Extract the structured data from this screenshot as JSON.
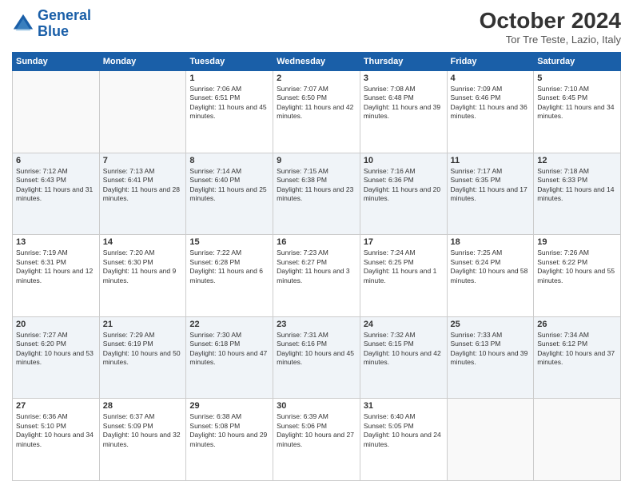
{
  "logo": {
    "line1": "General",
    "line2": "Blue"
  },
  "title": "October 2024",
  "subtitle": "Tor Tre Teste, Lazio, Italy",
  "headers": [
    "Sunday",
    "Monday",
    "Tuesday",
    "Wednesday",
    "Thursday",
    "Friday",
    "Saturday"
  ],
  "weeks": [
    [
      {
        "day": "",
        "details": ""
      },
      {
        "day": "",
        "details": ""
      },
      {
        "day": "1",
        "details": "Sunrise: 7:06 AM\nSunset: 6:51 PM\nDaylight: 11 hours and 45 minutes."
      },
      {
        "day": "2",
        "details": "Sunrise: 7:07 AM\nSunset: 6:50 PM\nDaylight: 11 hours and 42 minutes."
      },
      {
        "day": "3",
        "details": "Sunrise: 7:08 AM\nSunset: 6:48 PM\nDaylight: 11 hours and 39 minutes."
      },
      {
        "day": "4",
        "details": "Sunrise: 7:09 AM\nSunset: 6:46 PM\nDaylight: 11 hours and 36 minutes."
      },
      {
        "day": "5",
        "details": "Sunrise: 7:10 AM\nSunset: 6:45 PM\nDaylight: 11 hours and 34 minutes."
      }
    ],
    [
      {
        "day": "6",
        "details": "Sunrise: 7:12 AM\nSunset: 6:43 PM\nDaylight: 11 hours and 31 minutes."
      },
      {
        "day": "7",
        "details": "Sunrise: 7:13 AM\nSunset: 6:41 PM\nDaylight: 11 hours and 28 minutes."
      },
      {
        "day": "8",
        "details": "Sunrise: 7:14 AM\nSunset: 6:40 PM\nDaylight: 11 hours and 25 minutes."
      },
      {
        "day": "9",
        "details": "Sunrise: 7:15 AM\nSunset: 6:38 PM\nDaylight: 11 hours and 23 minutes."
      },
      {
        "day": "10",
        "details": "Sunrise: 7:16 AM\nSunset: 6:36 PM\nDaylight: 11 hours and 20 minutes."
      },
      {
        "day": "11",
        "details": "Sunrise: 7:17 AM\nSunset: 6:35 PM\nDaylight: 11 hours and 17 minutes."
      },
      {
        "day": "12",
        "details": "Sunrise: 7:18 AM\nSunset: 6:33 PM\nDaylight: 11 hours and 14 minutes."
      }
    ],
    [
      {
        "day": "13",
        "details": "Sunrise: 7:19 AM\nSunset: 6:31 PM\nDaylight: 11 hours and 12 minutes."
      },
      {
        "day": "14",
        "details": "Sunrise: 7:20 AM\nSunset: 6:30 PM\nDaylight: 11 hours and 9 minutes."
      },
      {
        "day": "15",
        "details": "Sunrise: 7:22 AM\nSunset: 6:28 PM\nDaylight: 11 hours and 6 minutes."
      },
      {
        "day": "16",
        "details": "Sunrise: 7:23 AM\nSunset: 6:27 PM\nDaylight: 11 hours and 3 minutes."
      },
      {
        "day": "17",
        "details": "Sunrise: 7:24 AM\nSunset: 6:25 PM\nDaylight: 11 hours and 1 minute."
      },
      {
        "day": "18",
        "details": "Sunrise: 7:25 AM\nSunset: 6:24 PM\nDaylight: 10 hours and 58 minutes."
      },
      {
        "day": "19",
        "details": "Sunrise: 7:26 AM\nSunset: 6:22 PM\nDaylight: 10 hours and 55 minutes."
      }
    ],
    [
      {
        "day": "20",
        "details": "Sunrise: 7:27 AM\nSunset: 6:20 PM\nDaylight: 10 hours and 53 minutes."
      },
      {
        "day": "21",
        "details": "Sunrise: 7:29 AM\nSunset: 6:19 PM\nDaylight: 10 hours and 50 minutes."
      },
      {
        "day": "22",
        "details": "Sunrise: 7:30 AM\nSunset: 6:18 PM\nDaylight: 10 hours and 47 minutes."
      },
      {
        "day": "23",
        "details": "Sunrise: 7:31 AM\nSunset: 6:16 PM\nDaylight: 10 hours and 45 minutes."
      },
      {
        "day": "24",
        "details": "Sunrise: 7:32 AM\nSunset: 6:15 PM\nDaylight: 10 hours and 42 minutes."
      },
      {
        "day": "25",
        "details": "Sunrise: 7:33 AM\nSunset: 6:13 PM\nDaylight: 10 hours and 39 minutes."
      },
      {
        "day": "26",
        "details": "Sunrise: 7:34 AM\nSunset: 6:12 PM\nDaylight: 10 hours and 37 minutes."
      }
    ],
    [
      {
        "day": "27",
        "details": "Sunrise: 6:36 AM\nSunset: 5:10 PM\nDaylight: 10 hours and 34 minutes."
      },
      {
        "day": "28",
        "details": "Sunrise: 6:37 AM\nSunset: 5:09 PM\nDaylight: 10 hours and 32 minutes."
      },
      {
        "day": "29",
        "details": "Sunrise: 6:38 AM\nSunset: 5:08 PM\nDaylight: 10 hours and 29 minutes."
      },
      {
        "day": "30",
        "details": "Sunrise: 6:39 AM\nSunset: 5:06 PM\nDaylight: 10 hours and 27 minutes."
      },
      {
        "day": "31",
        "details": "Sunrise: 6:40 AM\nSunset: 5:05 PM\nDaylight: 10 hours and 24 minutes."
      },
      {
        "day": "",
        "details": ""
      },
      {
        "day": "",
        "details": ""
      }
    ]
  ]
}
